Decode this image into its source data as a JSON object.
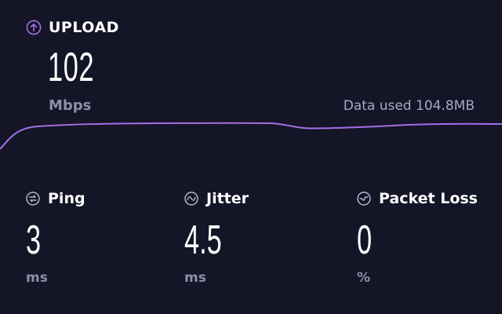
{
  "upload": {
    "title": "UPLOAD",
    "value": "102",
    "unit": "Mbps",
    "icon": "arrow-up-circle-icon",
    "accent_color": "#a46fe6"
  },
  "data_used": "Data used 104.8MB",
  "metrics": [
    {
      "label": "Ping",
      "value": "3",
      "unit": "ms",
      "icon": "ping-icon"
    },
    {
      "label": "Jitter",
      "value": "4.5",
      "unit": "ms",
      "icon": "jitter-wave-icon"
    },
    {
      "label": "Packet Loss",
      "value": "0",
      "unit": "%",
      "icon": "packet-loss-icon"
    }
  ],
  "colors": {
    "background": "#141526",
    "text": "#ffffff",
    "muted_text": "#8d8fa8",
    "graph_line": "#a46fe6"
  }
}
